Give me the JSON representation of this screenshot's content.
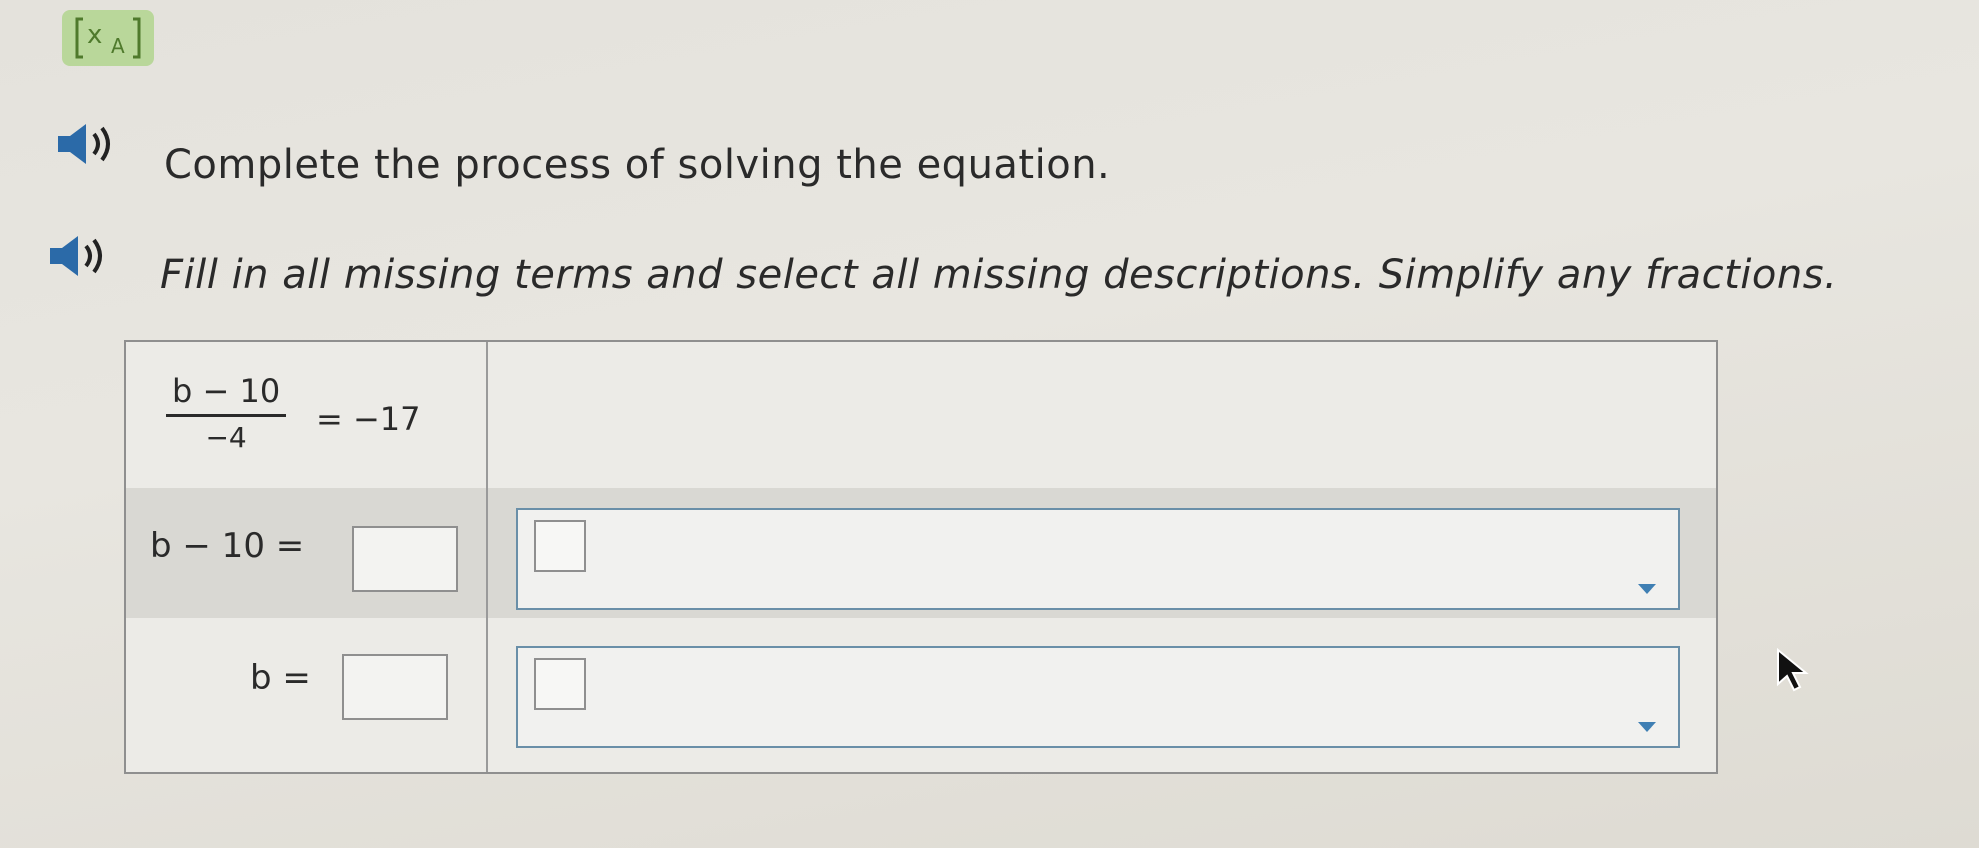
{
  "toolbar": {
    "translate_icon": "translate-icon",
    "translate_glyph_main": "x",
    "translate_glyph_sub": "A"
  },
  "instructions": {
    "line1": "Complete the process of solving the equation.",
    "line2": "Fill in all missing terms and select all missing descriptions. Simplify any fractions.",
    "speaker_icon": "speaker-icon"
  },
  "equation": {
    "step1": {
      "numerator": "b − 10",
      "denominator": "−4",
      "rhs": "= −17"
    },
    "step2": {
      "lhs": "b − 10 =",
      "answer_value": "",
      "description": ""
    },
    "step3": {
      "lhs": "b =",
      "answer_value": "",
      "description": ""
    }
  },
  "icons": {
    "dropdown_arrow": "chevron-down-icon",
    "pointer": "cursor-icon"
  },
  "colors": {
    "accent": "#3f7fb3",
    "translate_bg": "#b9d79a"
  }
}
